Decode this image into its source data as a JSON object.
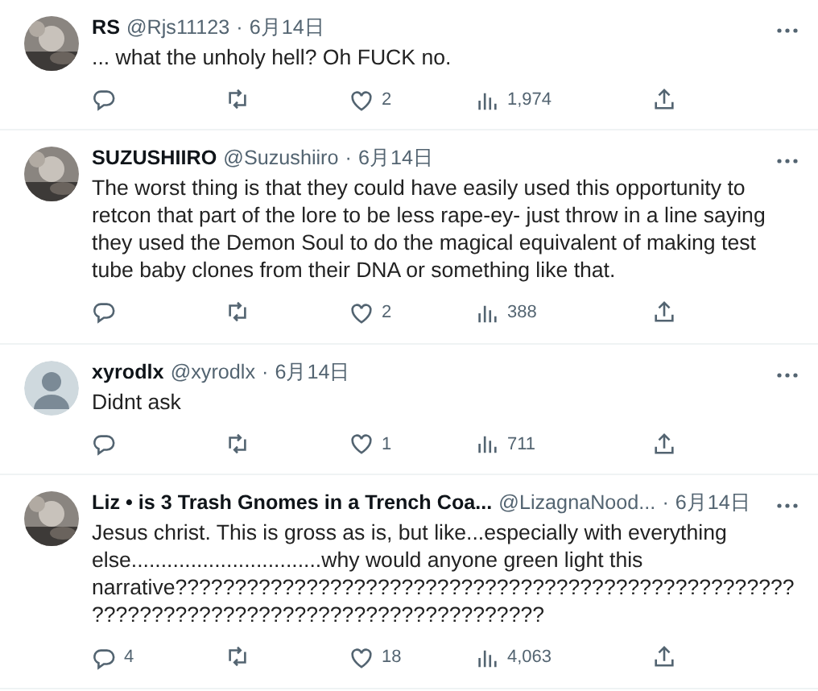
{
  "tweets": [
    {
      "name": "RS",
      "handle": "@Rjs11123",
      "separator": "·",
      "date": "6月14日",
      "text": "... what the unholy hell? Oh FUCK no.",
      "likes": "2",
      "views": "1,974"
    },
    {
      "name": "SUZUSHIIRO",
      "handle": "@Suzushiiro",
      "separator": "·",
      "date": "6月14日",
      "text": "The worst thing is that they could have easily used this opportunity to retcon that part of the lore to be less rape-ey- just throw in a line saying they used the Demon Soul to do the magical equivalent of making test tube baby clones from their DNA or something like that.",
      "likes": "2",
      "views": "388"
    },
    {
      "name": "xyrodlx",
      "handle": "@xyrodlx",
      "separator": "·",
      "date": "6月14日",
      "avatar": {
        "kind": "silhouette"
      },
      "text": "Didnt ask",
      "likes": "1",
      "views": "711"
    },
    {
      "name": "Liz • is 3 Trash Gnomes in a Trench Coa...",
      "handle": "@LizagnaNood...",
      "separator": "·",
      "date": "6月14日",
      "text": "Jesus christ. This is gross as is, but like...especially with everything else................................why would anyone green light this narrative??????????????????????????????????????????????????????????????????????????????????????????",
      "replies": "4",
      "likes": "18",
      "views": "4,063"
    }
  ]
}
